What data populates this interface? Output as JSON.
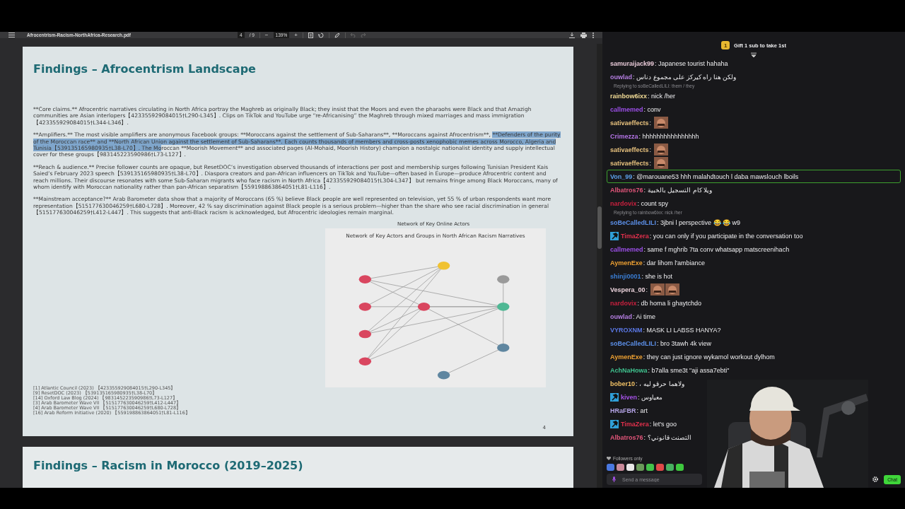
{
  "pdf_toolbar": {
    "filename": "Afrocentrism-Racism-NorthAfrica-Research.pdf",
    "page": "4",
    "page_total": "/ 9",
    "zoom_out": "−",
    "zoom": "139%",
    "zoom_in": "+"
  },
  "pages": [
    {
      "title": "Findings – Afrocentrism Landscape",
      "paragraphs": [
        {
          "segments": [
            {
              "text": "**Core claims.** Afrocentric narratives circulating in North Africa portray the Maghreb as originally Black; they insist that the Moors and even the pharaohs were Black and that Amazigh communities are Asian interlopers【423355929084015†L290-L345】. Clips on TikTok and YouTube urge “re-Africanising” the Maghreb through mixed marriages and mass immigration【423355929084015†L344-L346】.",
              "highlighted": false
            }
          ]
        },
        {
          "segments": [
            {
              "text": "**Amplifiers.** The most visible amplifiers are anonymous Facebook groups: **Moroccans against the settlement of Sub-Saharans**, **Moroccans against Afrocentrism**, ",
              "highlighted": false
            },
            {
              "text": "**Defenders of the purity of the Moroccan race** and **North African Union against the settlement of Sub-Saharans**. Each counts thousands of members and cross-posts xenophobic memes across Morocco, Algeria and Tunisia【539135165980935†L38-L70】. The Mo",
              "highlighted": true
            },
            {
              "text": "roccan **Moorish Movement** and associated pages (Al-Mohaid, Moorish History) champion a nostalgic nationalist identity and supply intellectual cover for these groups【983145223590986†L73-L127】.",
              "highlighted": false
            }
          ]
        },
        {
          "segments": [
            {
              "text": "**Reach & audience.** Precise follower counts are opaque, but ResetDOC’s investigation observed thousands of interactions per post and membership surges following Tunisian President Kais Saied’s February 2023 speech【539135165980935†L38-L70】. Diaspora creators and pan-African influencers on TikTok and YouTube—often based in Europe—produce Afrocentric content and reach millions. Their discourse resonates with some Sub-Saharan migrants who face racism in North Africa【423355929084015†L304-L347】 but remains fringe among Black Moroccans, many of whom identify with Moroccan nationality rather than pan-African separatism【559198863864051†L81-L116】.",
              "highlighted": false
            }
          ]
        },
        {
          "segments": [
            {
              "text": "**Mainstream acceptance?** Arab Barometer data show that a majority of Moroccans (65 %) believe Black people are well represented on television, yet 55 % of urban respondents want more representation【515177630046259†L680-L728】. Moreover, 42 % say discrimination against Black people is a serious problem—higher than the share who see racial discrimination in general【515177630046259†L412-L447】. This suggests that anti-Black racism is acknowledged, but Afrocentric ideologies remain marginal.",
              "highlighted": false
            }
          ]
        }
      ],
      "overlay_caption": "Network of Key Online Actors",
      "figure": {
        "title": "Network of Key Actors and Groups in North African Racism Narratives"
      },
      "footnotes": [
        "[1] Atlantic Council (2023) 【423355929084015†L290-L345】",
        "[9] ResetDOC (2023) 【539135165980935†L38-L70】",
        "[14] Oxford Law Blog (2024) 【983145223590986†L73-L127】",
        "[3] Arab Barometer Wave VII 【515177630046259†L412-L447】",
        "[4] Arab Barometer Wave VII 【515177630046259†L680-L728】",
        "[16] Arab Reform Initiative (2020) 【559198863864051†L81-L116】"
      ],
      "page_number": "4"
    },
    {
      "title": "Findings – Racism in Morocco (2019–2025)"
    }
  ],
  "chat": {
    "banner": {
      "badge": "1",
      "text": "Gift 1 sub to take 1st"
    },
    "messages": [
      {
        "user": "samuraijack99",
        "color": "#e6c8d6",
        "text": ": Japanese tourist hahaha",
        "mod": false,
        "highlighted": false
      },
      {
        "user": "ouwlad",
        "color": "#b47ee0",
        "text": ": ولكن هنا راه كيركز على مجموع دناس",
        "mod": false,
        "highlighted": false
      },
      {
        "user": "rainbow6ixx",
        "color": "#f2dc96",
        "text": ": nick /her",
        "mod": false,
        "highlighted": false,
        "reply": "Replying to soBeCalledLILI: them / they"
      },
      {
        "user": "callmemed",
        "color": "#9b4fe6",
        "text": ": conv",
        "mod": false,
        "highlighted": false
      },
      {
        "user": "sativaeffects",
        "color": "#e8c27e",
        "text": ":",
        "mod": false,
        "highlighted": false,
        "emotes": [
          {
            "kind": "face"
          }
        ]
      },
      {
        "user": "Crimezza",
        "color": "#b374e6",
        "text": ": hhhhhhhhhhhhhhhh",
        "mod": false,
        "highlighted": false
      },
      {
        "user": "sativaeffects",
        "color": "#e8c27e",
        "text": ":",
        "mod": false,
        "highlighted": false,
        "emotes": [
          {
            "kind": "face"
          }
        ]
      },
      {
        "user": "sativaeffects",
        "color": "#e8c27e",
        "text": ":",
        "mod": false,
        "highlighted": false,
        "emotes": [
          {
            "kind": "face"
          }
        ]
      },
      {
        "user": "Von_99",
        "color": "#5b9ee6",
        "text": ": @marouane53 hhh malahdtouch l daba mawslouch lboils",
        "mod": false,
        "highlighted": true
      },
      {
        "user": "Albatros76",
        "color": "#e2557a",
        "text": ": ويلا كام التسجيل بالخبية",
        "mod": false,
        "highlighted": false
      },
      {
        "user": "nardovix",
        "color": "#c8203e",
        "text": ": count spy",
        "mod": false,
        "highlighted": false
      },
      {
        "user": "soBeCalledLILI",
        "color": "#5b8ee6",
        "text": ": 3jbni l perspective 😂 😂 w9",
        "mod": false,
        "highlighted": false,
        "reply": "Replying to rainbow6ixx: nick /her"
      },
      {
        "user": "TimaZera",
        "color": "#e0304c",
        "text": ": you can only if you participate in the conversation too",
        "mod": true,
        "highlighted": false
      },
      {
        "user": "callmemed",
        "color": "#9b4fe6",
        "text": ": same f mghrib 7ta conv whatsapp matscreenihach",
        "mod": false,
        "highlighted": false
      },
      {
        "user": "AymenExe",
        "color": "#f0a232",
        "text": ": dar lihom l'ambiance",
        "mod": false,
        "highlighted": false
      },
      {
        "user": "shinji0001",
        "color": "#3b7fd6",
        "text": ": she is hot",
        "mod": false,
        "highlighted": false
      },
      {
        "user": "Vespera_00",
        "color": "#ead2da",
        "text": ":",
        "mod": false,
        "highlighted": false,
        "emotes": [
          {
            "kind": "face"
          },
          {
            "kind": "face"
          }
        ]
      },
      {
        "user": "nardovix",
        "color": "#c8203e",
        "text": ": db homa li ghaytchdo",
        "mod": false,
        "highlighted": false
      },
      {
        "user": "ouwlad",
        "color": "#b47ee0",
        "text": ": Ai time",
        "mod": false,
        "highlighted": false
      },
      {
        "user": "VYROXNM",
        "color": "#5b78e6",
        "text": ": MASK LI LABSS HANYA?",
        "mod": false,
        "highlighted": false
      },
      {
        "user": "soBeCalledLILI",
        "color": "#5b8ee6",
        "text": ": bro 3tawh 4k view",
        "mod": false,
        "highlighted": false
      },
      {
        "user": "AymenExe",
        "color": "#f0a232",
        "text": ": they can just ignore wykamol workout dylhom",
        "mod": false,
        "highlighted": false
      },
      {
        "user": "AchNaHowa",
        "color": "#3fc28e",
        "text": ": b7alla sme3t \"aji assa7ebti\"",
        "mod": false,
        "highlighted": false
      },
      {
        "user": "bober10",
        "color": "#f2c266",
        "text": ": ، ولاهما حرقو ليه",
        "mod": false,
        "highlighted": false
      },
      {
        "user": "kiven",
        "color": "#a552e6",
        "text": ": معياوس",
        "mod": true,
        "highlighted": false
      },
      {
        "user": "HRaFBR",
        "color": "#b4a4e6",
        "text": ": art",
        "mod": false,
        "highlighted": false
      },
      {
        "user": "TimaZera",
        "color": "#e0304c",
        "text": ": let's goo",
        "mod": true,
        "highlighted": false
      },
      {
        "user": "Albatros76",
        "color": "#e2557a",
        "text": ": التصنت قانوني؟",
        "mod": false,
        "highlighted": false
      }
    ],
    "followers_only": "Followers only",
    "placeholder": "Send a message",
    "send": "Chat"
  }
}
